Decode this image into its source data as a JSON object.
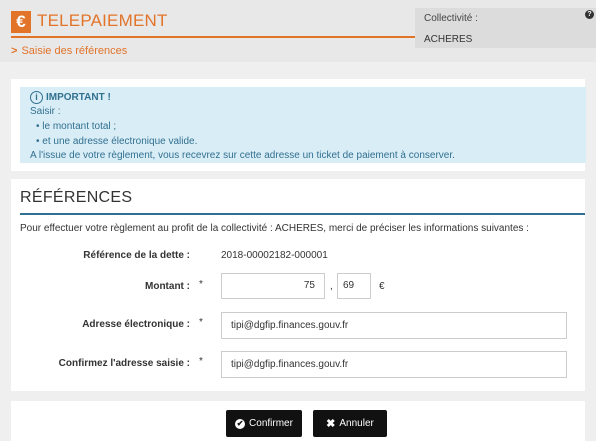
{
  "header": {
    "logo_symbol": "€",
    "title": "TELEPAIEMENT",
    "breadcrumb_chevron": ">",
    "breadcrumb": "Saisie des références",
    "collectivite_label": "Collectivité :",
    "collectivite_value": "ACHERES",
    "help_symbol": "?"
  },
  "info": {
    "icon": "i",
    "title": "IMPORTANT !",
    "intro": "Saisir :",
    "bullets": [
      "le montant total ;",
      "et une adresse électronique valide."
    ],
    "note": "A l'issue de votre règlement, vous recevrez sur cette adresse un ticket de paiement à conserver."
  },
  "references": {
    "title": "RÉFÉRENCES",
    "intro": "Pour effectuer votre règlement au profit de la collectivité : ACHERES, merci de préciser les informations suivantes :",
    "ref_label": "Référence de la dette :",
    "ref_value": "2018-00002182-000001",
    "amount_label": "Montant :",
    "required_mark": "*",
    "amount_euros": "75",
    "amount_separator": ",",
    "amount_cents": "69",
    "currency": "€",
    "email_label": "Adresse électronique :",
    "email_value": "tipi@dgfip.finances.gouv.fr",
    "confirm_label": "Confirmez l'adresse saisie :",
    "confirm_value": "tipi@dgfip.finances.gouv.fr"
  },
  "actions": {
    "confirm_icon": "✔",
    "confirm_label": "Confirmer",
    "cancel_icon": "✖",
    "cancel_label": "Annuler"
  },
  "colors": {
    "accent": "#e2742a",
    "info_bg": "#d9edf7",
    "info_text": "#31708f",
    "button_bg": "#111111"
  }
}
